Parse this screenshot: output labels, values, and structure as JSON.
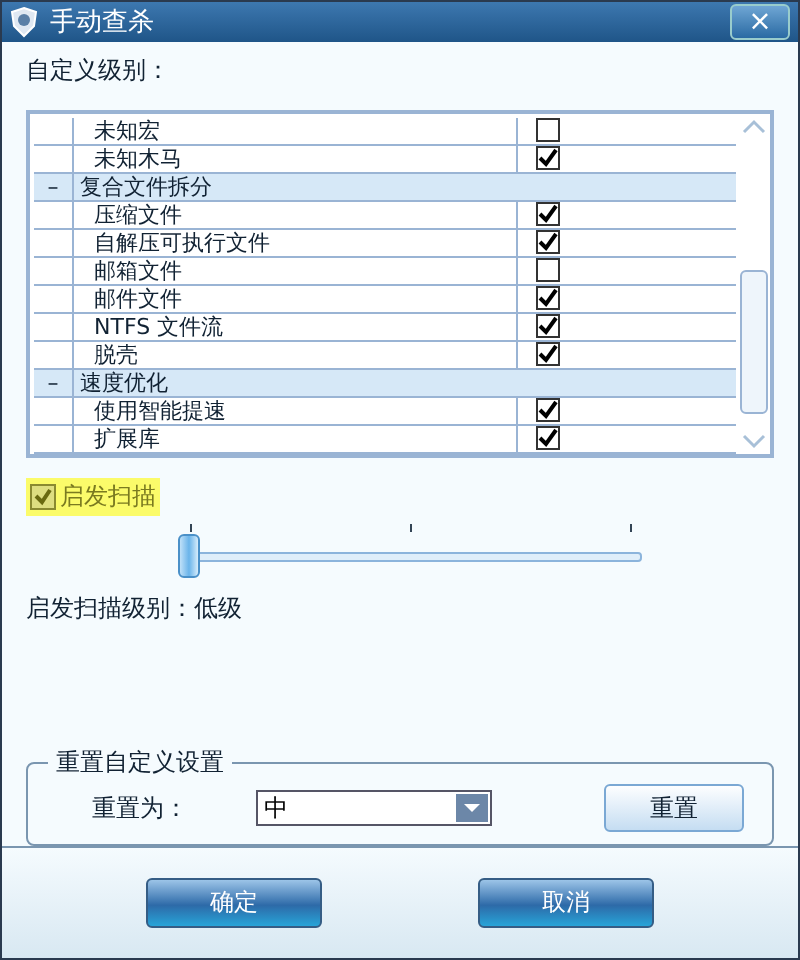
{
  "window": {
    "title": "手动查杀",
    "close": "×"
  },
  "custom_level": {
    "label": "自定义级别：",
    "rows": [
      {
        "kind": "item",
        "label": "未知宏",
        "checked": false
      },
      {
        "kind": "item",
        "label": "未知木马",
        "checked": true
      },
      {
        "kind": "group",
        "label": "复合文件拆分",
        "toggle": "–",
        "expanded": true,
        "children": [
          {
            "kind": "item",
            "label": "压缩文件",
            "checked": true
          },
          {
            "kind": "item",
            "label": "自解压可执行文件",
            "checked": true
          },
          {
            "kind": "item",
            "label": "邮箱文件",
            "checked": false
          },
          {
            "kind": "item",
            "label": "邮件文件",
            "checked": true
          },
          {
            "kind": "item",
            "label": "NTFS 文件流",
            "checked": true
          },
          {
            "kind": "item",
            "label": "脱壳",
            "checked": true
          }
        ]
      },
      {
        "kind": "group",
        "label": "速度优化",
        "toggle": "–",
        "expanded": true,
        "children": [
          {
            "kind": "item",
            "label": "使用智能提速",
            "checked": true
          },
          {
            "kind": "item",
            "label": "扩展库",
            "checked": true
          }
        ]
      }
    ]
  },
  "heuristic": {
    "label": "启发扫描",
    "checked": true,
    "level": 0,
    "level_text": "启发扫描级别：低级"
  },
  "reset": {
    "legend": "重置自定义设置",
    "label": "重置为：",
    "value": "中",
    "button": "重置"
  },
  "buttons": [
    "确定",
    "取消"
  ]
}
